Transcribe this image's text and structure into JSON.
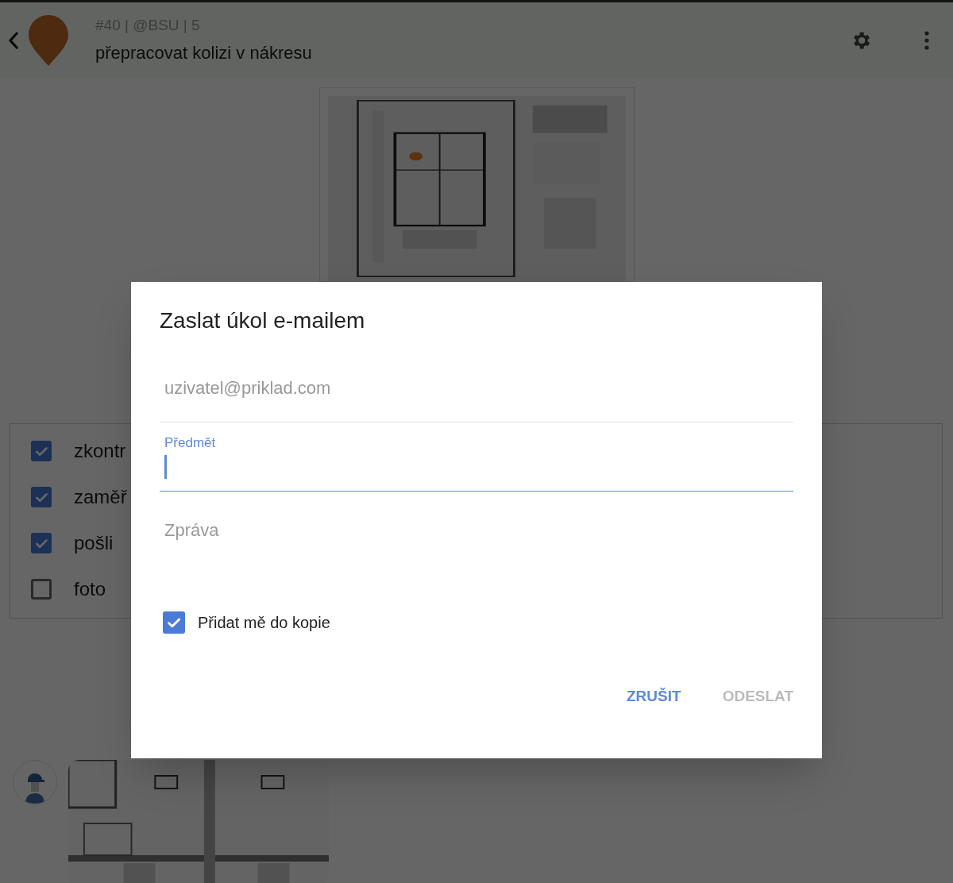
{
  "header": {
    "meta": "#40 | @BSU | 5",
    "title": "přepracovat kolizi v nákresu"
  },
  "checklist": [
    {
      "label": "zkontr",
      "checked": true
    },
    {
      "label": "zaměř",
      "checked": true
    },
    {
      "label": "pošli",
      "checked": true
    },
    {
      "label": "foto",
      "checked": false
    }
  ],
  "dialog": {
    "title": "Zaslat úkol e-mailem",
    "fields": [
      {
        "kind": "input",
        "placeholder": "uzivatel@priklad.com",
        "focused": false
      },
      {
        "kind": "input",
        "label": "Předmět",
        "focused": true
      },
      {
        "kind": "textarea",
        "placeholder": "Zpráva",
        "focused": false
      }
    ],
    "cc": {
      "label": "Přidat mě do kopie",
      "checked": true
    },
    "buttons": [
      {
        "label": "ZRUŠIT",
        "disabled": false
      },
      {
        "label": "ODESLAT",
        "disabled": true
      }
    ]
  }
}
